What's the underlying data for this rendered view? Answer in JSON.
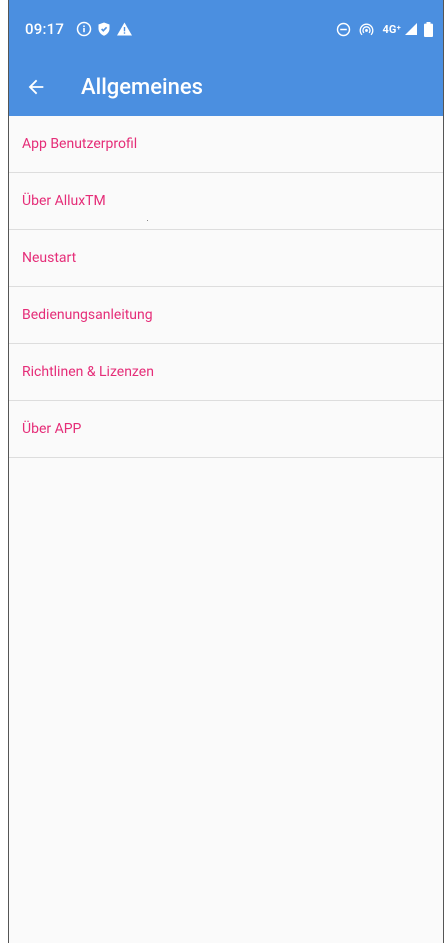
{
  "colors": {
    "primary": "#4b8fe0",
    "accent_text": "#e52d78",
    "background": "#fafafa",
    "divider": "#dddddd"
  },
  "status_bar": {
    "time": "09:17",
    "network_label": "4G⁺",
    "icons_left": [
      "info-icon",
      "shield-icon",
      "warning-icon"
    ],
    "icons_right": [
      "do-not-disturb-icon",
      "hotspot-icon",
      "network-label",
      "signal-icon",
      "battery-icon"
    ]
  },
  "app_bar": {
    "back_icon": "arrow-back-icon",
    "title": "Allgemeines"
  },
  "menu": {
    "items": [
      {
        "label": "App Benutzerprofil"
      },
      {
        "label": "Über AlluxTM"
      },
      {
        "label": "Neustart"
      },
      {
        "label": "Bedienungsanleitung"
      },
      {
        "label": "Richtlinen & Lizenzen"
      },
      {
        "label": "Über APP"
      }
    ]
  }
}
